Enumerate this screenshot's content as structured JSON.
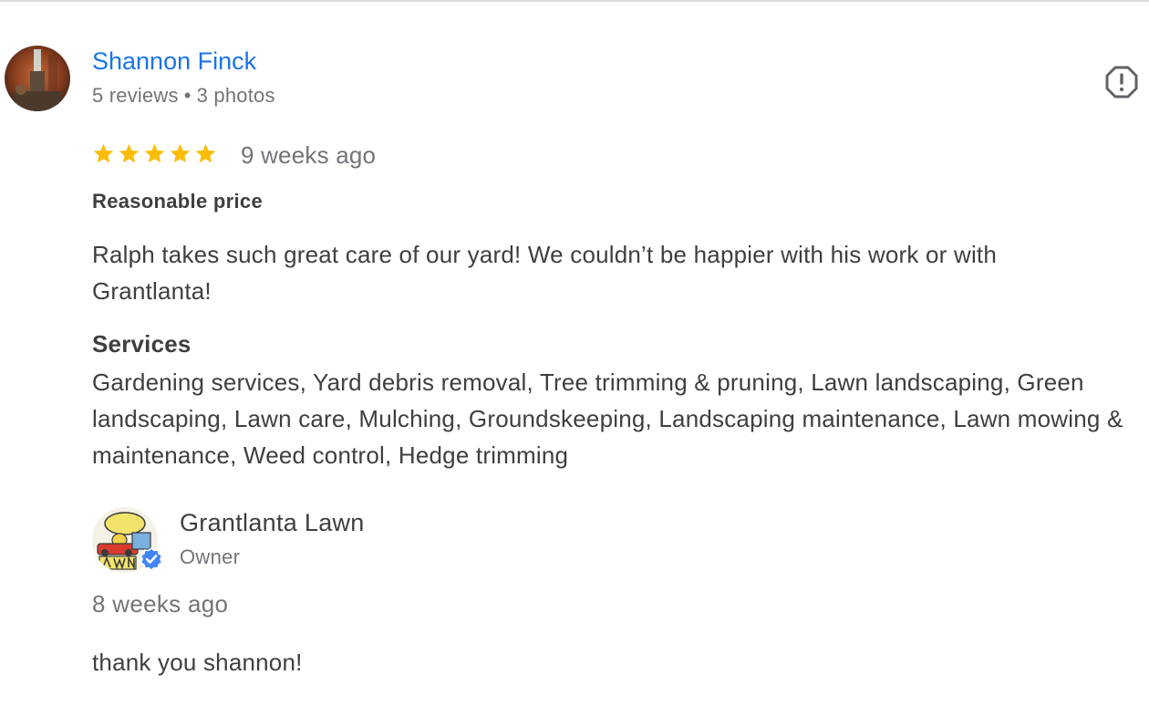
{
  "review": {
    "reviewer": {
      "name": "Shannon Finck",
      "reviews_count": "5 reviews",
      "separator": "•",
      "photos_count": "3 photos",
      "avatar_icon": "user-photo-avatar"
    },
    "rating": 5,
    "rating_max": 5,
    "star_color": "#fbbc04",
    "date": "9 weeks ago",
    "attribute": "Reasonable price",
    "text": "Ralph takes such great care of our yard! We couldn’t be happier with his work or with Grantlanta!",
    "services": {
      "title": "Services",
      "list": "Gardening services, Yard debris removal, Tree trimming & pruning, Lawn landscaping, Green landscaping, Lawn care, Mulching, Groundskeeping, Landscaping maintenance, Lawn mowing & maintenance, Weed control, Hedge trimming"
    },
    "flag_icon": "report-flag-icon"
  },
  "owner_reply": {
    "name": "Grantlanta Lawn",
    "role": "Owner",
    "avatar_icon": "business-logo-avatar",
    "verified_icon": "verified-badge-icon",
    "date": "8 weeks ago",
    "text": "thank you shannon!"
  },
  "colors": {
    "link_blue": "#1a73e8",
    "text": "#3c4043",
    "muted": "#70757a",
    "verified_blue": "#4285f4",
    "star": "#fbbc04"
  }
}
